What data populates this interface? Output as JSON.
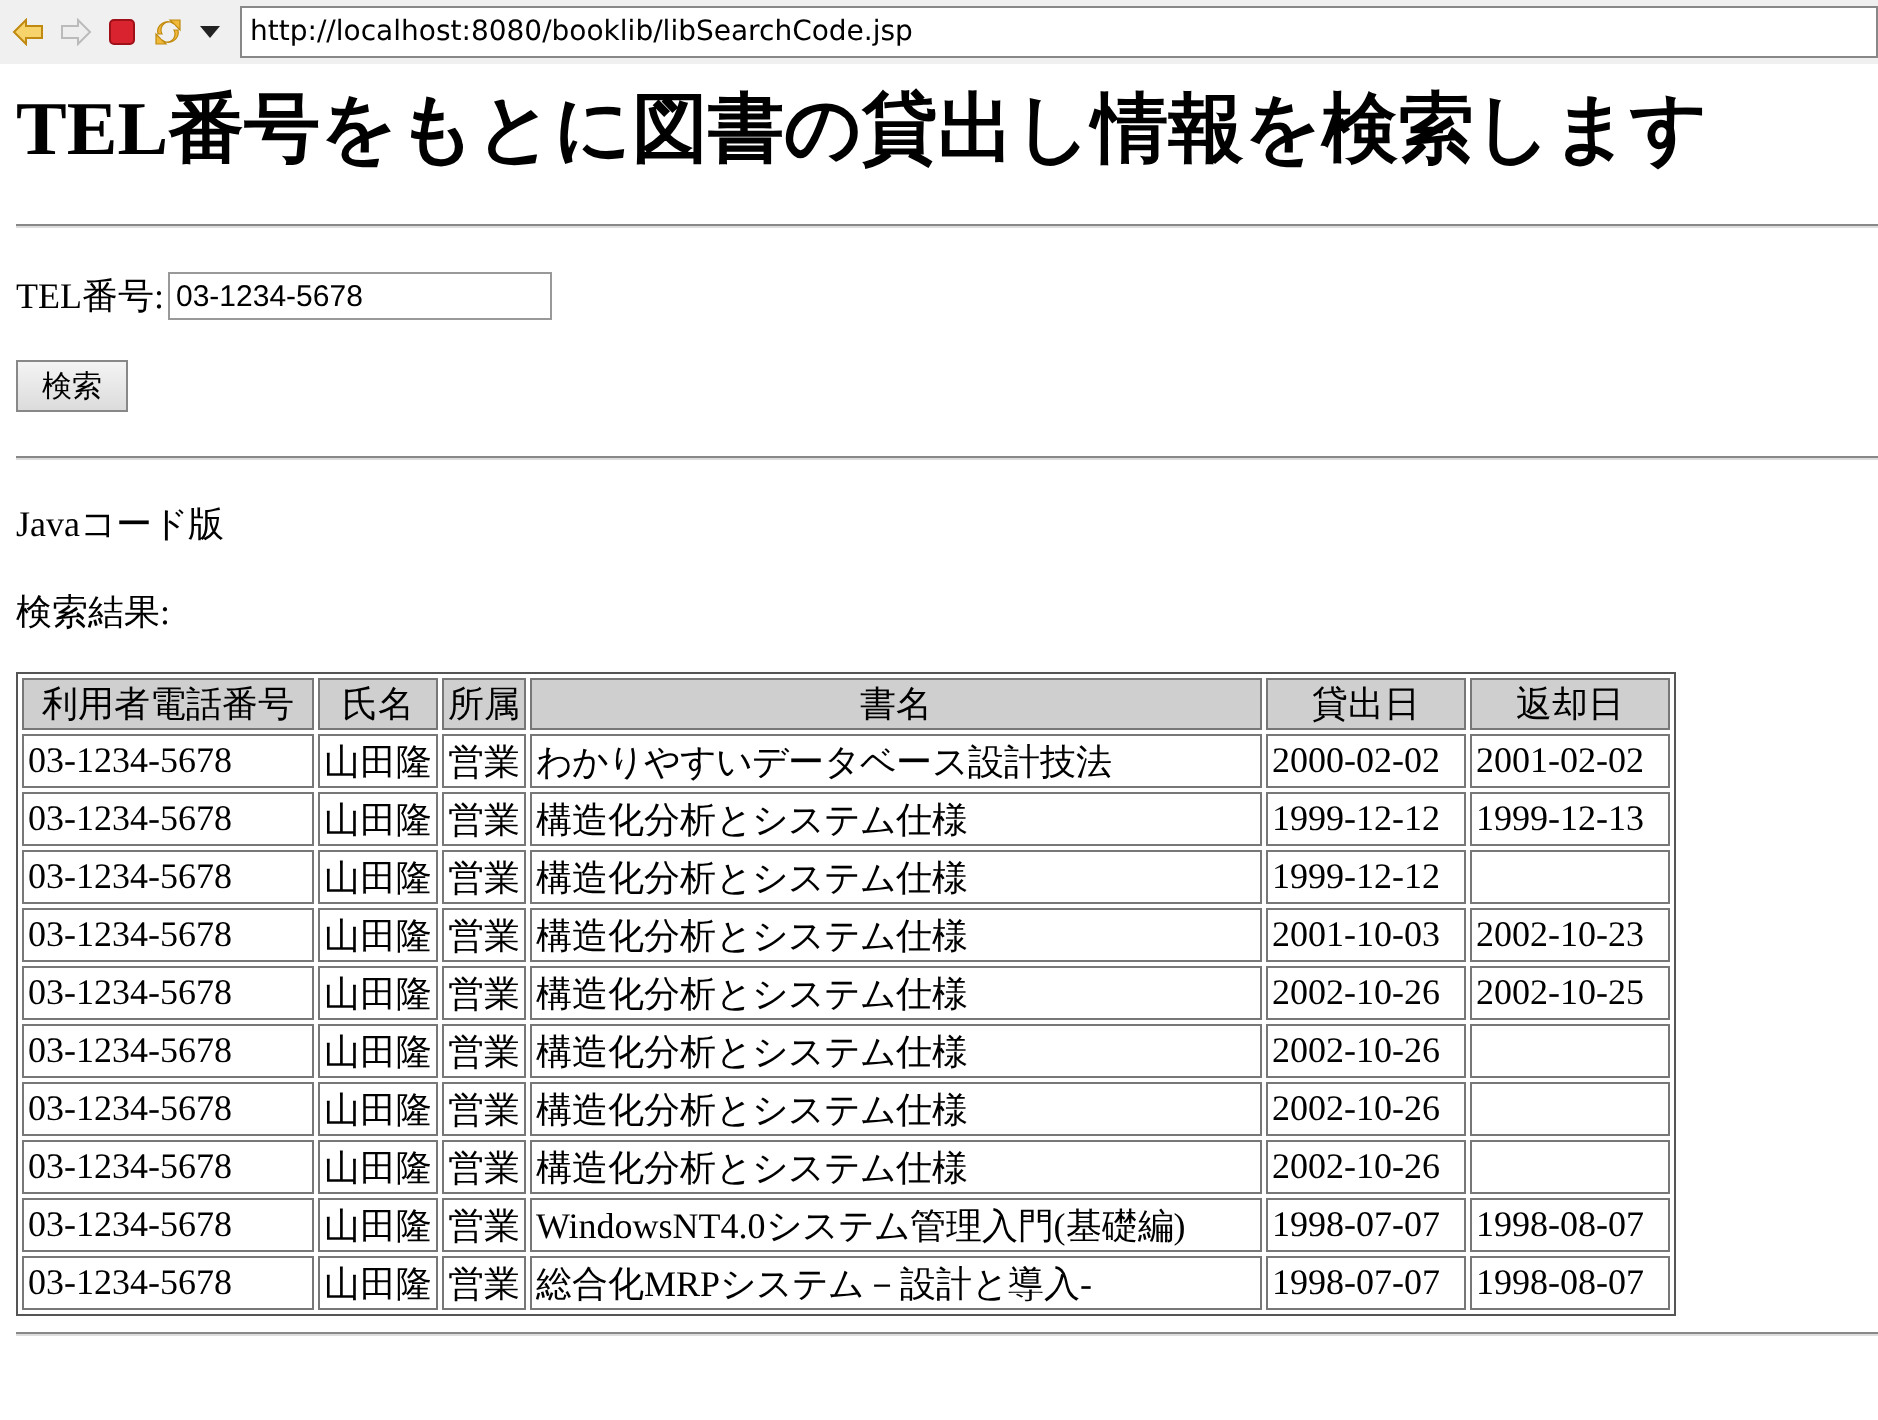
{
  "browser": {
    "url": "http://localhost:8080/booklib/libSearchCode.jsp"
  },
  "heading": "TEL番号をもとに図書の貸出し情報を検索します",
  "search": {
    "label": "TEL番号:",
    "value": "03-1234-5678",
    "button": "検索"
  },
  "version_note": "Javaコード版",
  "results_label": "検索結果:",
  "table": {
    "columns": [
      "利用者電話番号",
      "氏名",
      "所属",
      "書名",
      "貸出日",
      "返却日"
    ],
    "rows": [
      {
        "phone": "03-1234-5678",
        "name": "山田隆",
        "dept": "営業",
        "title": "わかりやすいデータベース設計技法",
        "loan_date": "2000-02-02",
        "return_date": "2001-02-02"
      },
      {
        "phone": "03-1234-5678",
        "name": "山田隆",
        "dept": "営業",
        "title": "構造化分析とシステム仕様",
        "loan_date": "1999-12-12",
        "return_date": "1999-12-13"
      },
      {
        "phone": "03-1234-5678",
        "name": "山田隆",
        "dept": "営業",
        "title": "構造化分析とシステム仕様",
        "loan_date": "1999-12-12"
      },
      {
        "phone": "03-1234-5678",
        "name": "山田隆",
        "dept": "営業",
        "title": "構造化分析とシステム仕様",
        "loan_date": "2001-10-03",
        "return_date": "2002-10-23"
      },
      {
        "phone": "03-1234-5678",
        "name": "山田隆",
        "dept": "営業",
        "title": "構造化分析とシステム仕様",
        "loan_date": "2002-10-26",
        "return_date": "2002-10-25"
      },
      {
        "phone": "03-1234-5678",
        "name": "山田隆",
        "dept": "営業",
        "title": "構造化分析とシステム仕様",
        "loan_date": "2002-10-26"
      },
      {
        "phone": "03-1234-5678",
        "name": "山田隆",
        "dept": "営業",
        "title": "構造化分析とシステム仕様",
        "loan_date": "2002-10-26"
      },
      {
        "phone": "03-1234-5678",
        "name": "山田隆",
        "dept": "営業",
        "title": "構造化分析とシステム仕様",
        "loan_date": "2002-10-26"
      },
      {
        "phone": "03-1234-5678",
        "name": "山田隆",
        "dept": "営業",
        "title": "WindowsNT4.0システム管理入門(基礎編)",
        "loan_date": "1998-07-07",
        "return_date": "1998-08-07"
      },
      {
        "phone": "03-1234-5678",
        "name": "山田隆",
        "dept": "営業",
        "title": "総合化MRPシステム－設計と導入-",
        "loan_date": "1998-07-07",
        "return_date": "1998-08-07"
      }
    ]
  }
}
